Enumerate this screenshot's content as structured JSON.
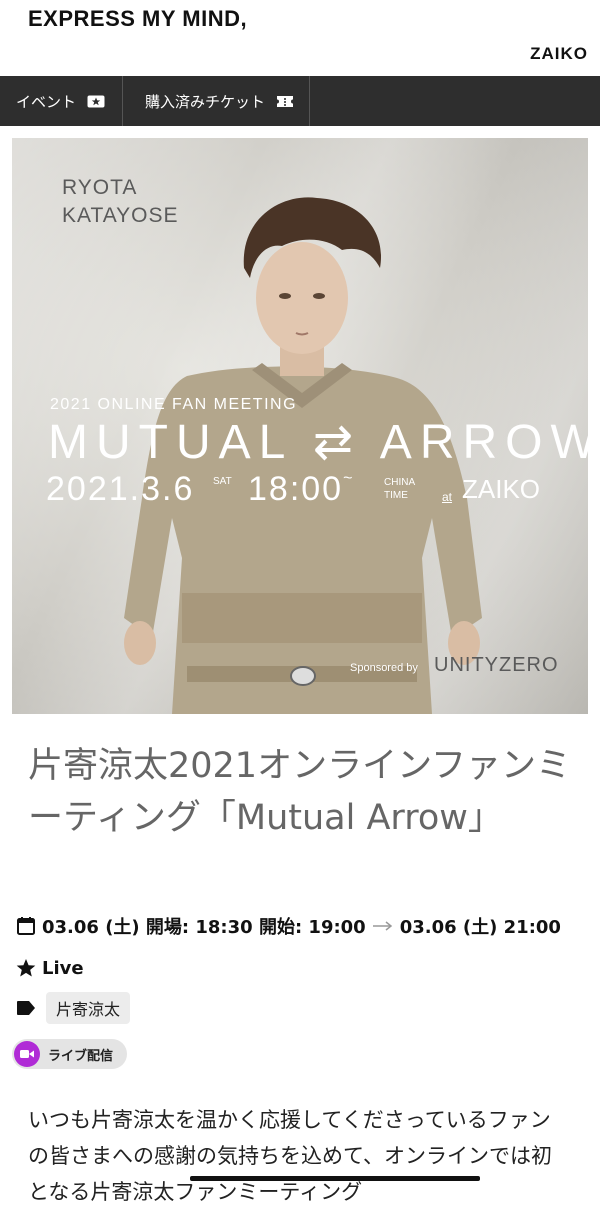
{
  "header": {
    "brand": "EXPRESS MY MIND,",
    "logo": "ZAIKO"
  },
  "nav": {
    "items": [
      {
        "label": "イベント",
        "icon": "ticket-star-icon"
      },
      {
        "label": "購入済みチケット",
        "icon": "ticket-icon"
      }
    ]
  },
  "poster": {
    "artist_line1": "RYOTA",
    "artist_line2": "KATAYOSE",
    "subtitle": "2021 ONLINE FAN MEETING",
    "title": "MUTUAL ⇄ ARROW",
    "date": "2021.3.6",
    "weekday": "SAT",
    "time": "18:00",
    "tilde": "~",
    "timezone_line1": "CHINA",
    "timezone_line2": "TIME",
    "at": "at",
    "venue": "ZAIKO",
    "sponsor_label": "Sponsored by",
    "sponsor": "UNITYZERO"
  },
  "event": {
    "title": "片寄涼太2021オンラインファンミーティング「Mutual Arrow」",
    "schedule": "03.06 (土) 開場: 18:30 開始: 19:00",
    "schedule_end": "03.06 (土) 21:00",
    "status": "Live",
    "tag": "片寄涼太",
    "stream_label": "ライブ配信",
    "description": "いつも片寄涼太を温かく応援してくださっているファンの皆さまへの感謝の気持ちを込めて、オンラインでは初となる片寄涼太ファンミーティング"
  },
  "colors": {
    "nav_bg": "#2e2e2e",
    "stream_accent": "#b02bd6",
    "title_gray": "#666666"
  }
}
